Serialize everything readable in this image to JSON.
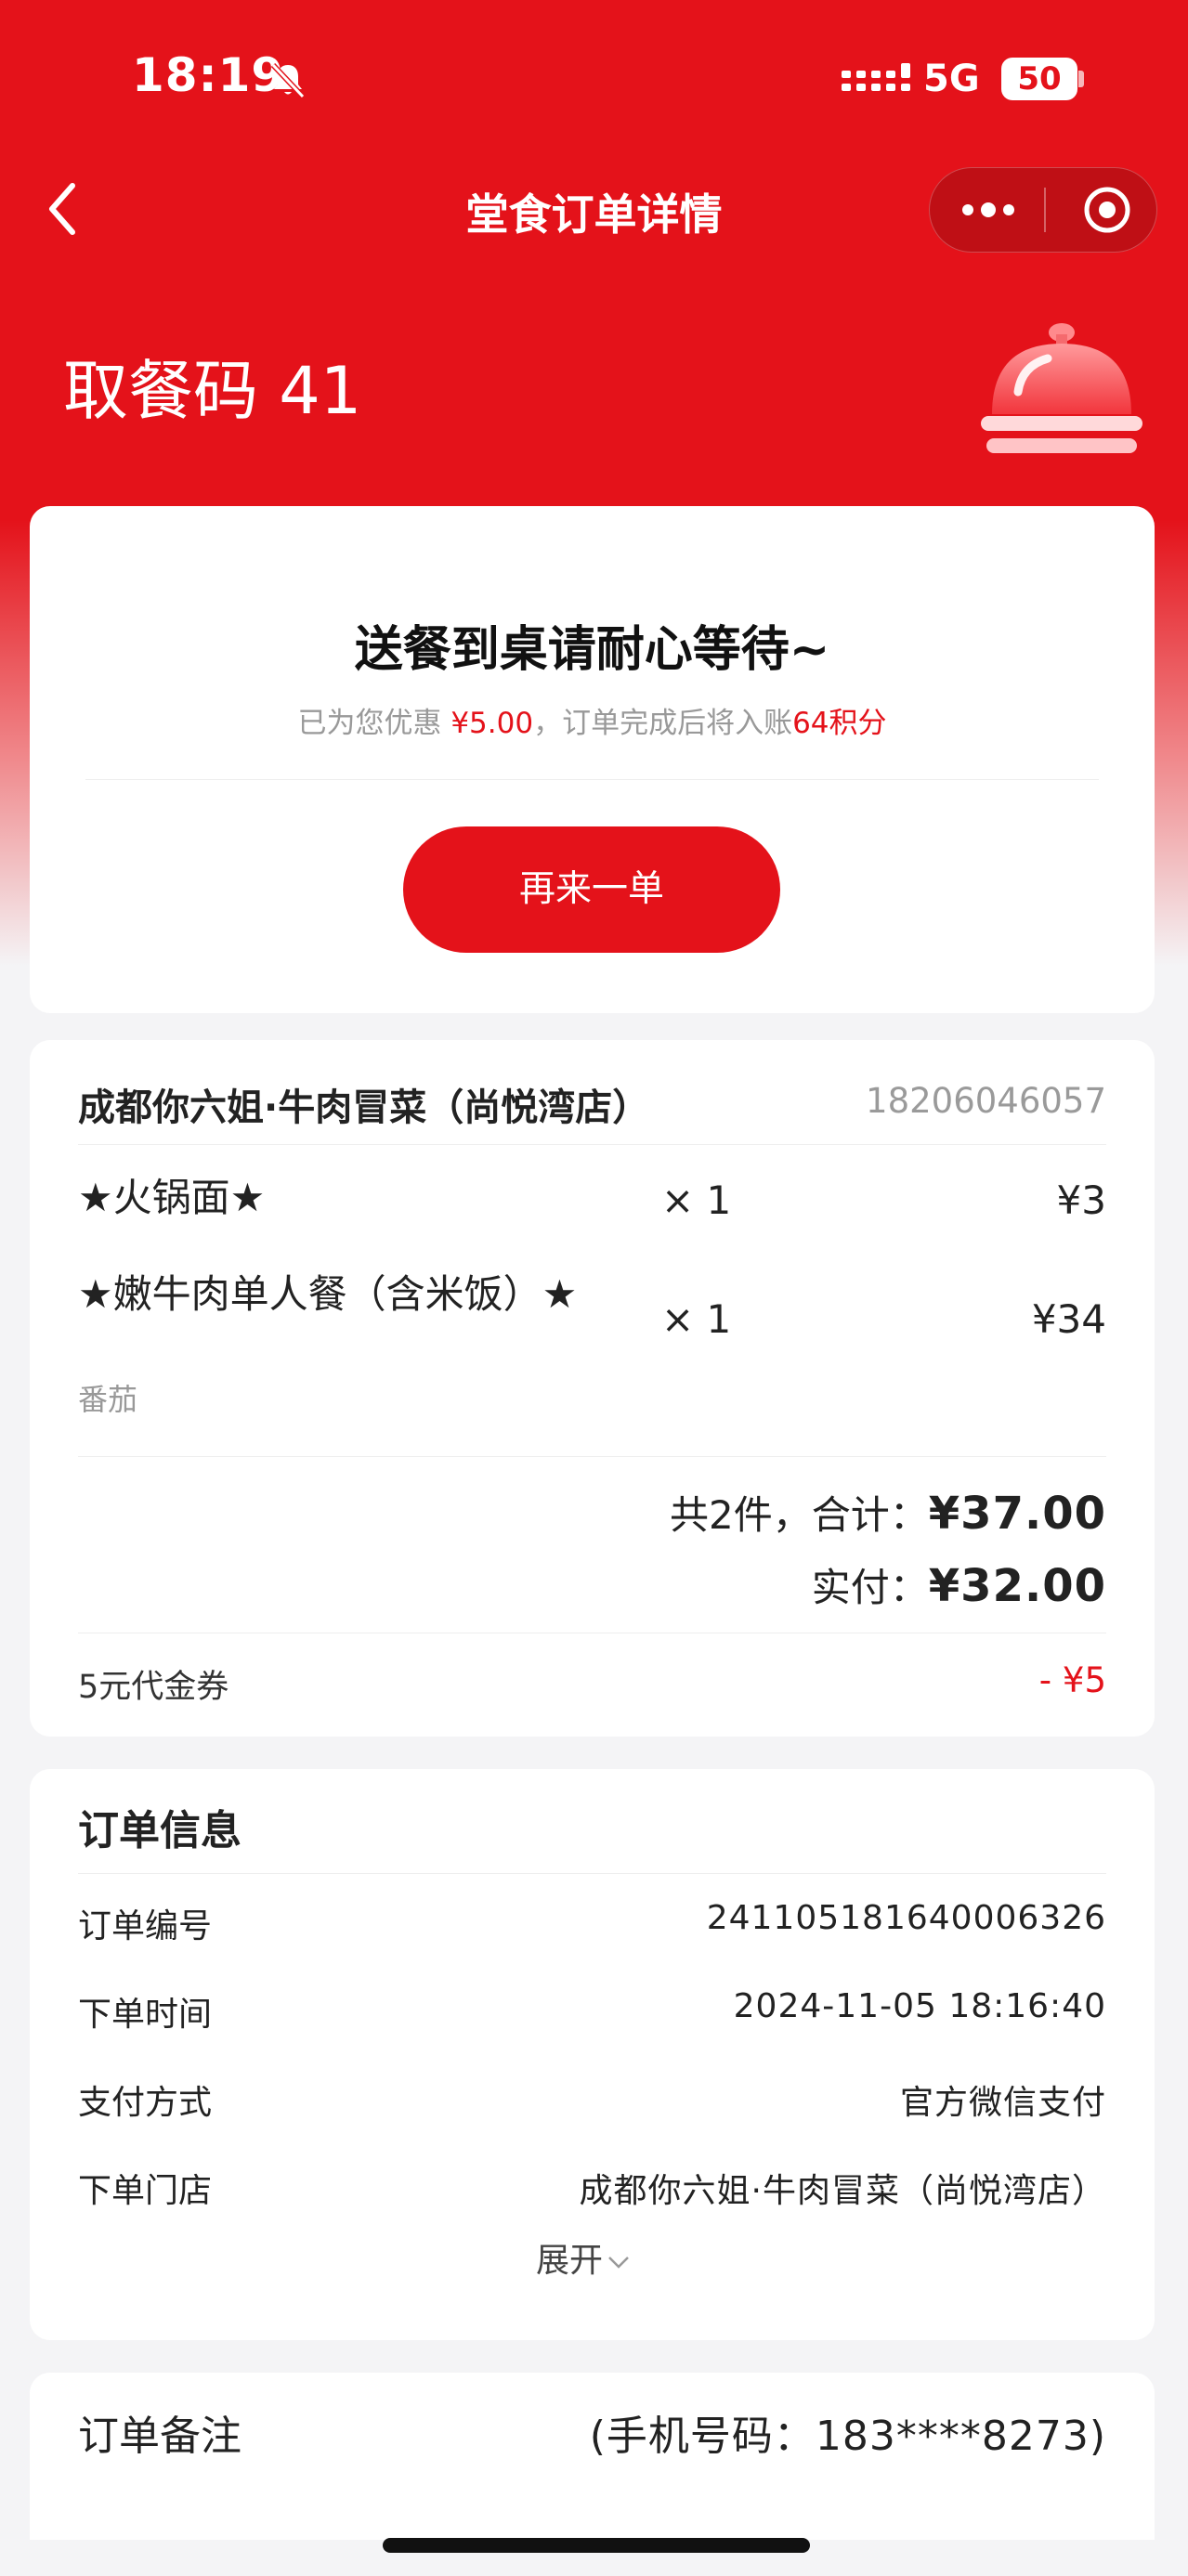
{
  "status_bar": {
    "time": "18:19",
    "network": "5G",
    "battery": "50"
  },
  "nav": {
    "title": "堂食订单详情"
  },
  "pickup": {
    "label": "取餐码 41"
  },
  "status_card": {
    "title": "送餐到桌请耐心等待~",
    "sub_prefix": "已为您优惠 ",
    "discount": "¥5.00",
    "sub_middle": "，订单完成后将入账",
    "points": "64积分",
    "reorder_label": "再来一单"
  },
  "order": {
    "store_name": "成都你六姐·牛肉冒菜（尚悦湾店）",
    "store_phone": "18206046057",
    "items": [
      {
        "name": "★火锅面★",
        "qty": "× 1",
        "price": "¥3",
        "spec": ""
      },
      {
        "name": "★嫩牛肉单人餐（含米饭）★",
        "qty": "× 1",
        "price": "¥34",
        "spec": "番茄"
      }
    ],
    "total_prefix": "共2件，合计：",
    "total": "¥37.00",
    "paid_prefix": "实付：",
    "paid": "¥32.00",
    "coupon_name": "5元代金券",
    "coupon_amount": "- ¥5"
  },
  "info": {
    "title": "订单信息",
    "rows": [
      {
        "label": "订单编号",
        "value": "241105181640006326"
      },
      {
        "label": "下单时间",
        "value": "2024-11-05 18:16:40"
      },
      {
        "label": "支付方式",
        "value": "官方微信支付"
      },
      {
        "label": "下单门店",
        "value": "成都你六姐·牛肉冒菜（尚悦湾店）"
      }
    ],
    "expand_label": "展开"
  },
  "remark": {
    "label": "订单备注",
    "value": "(手机号码：183****8273)"
  },
  "colors": {
    "brand_red": "#e4121a",
    "muted": "#999999"
  }
}
